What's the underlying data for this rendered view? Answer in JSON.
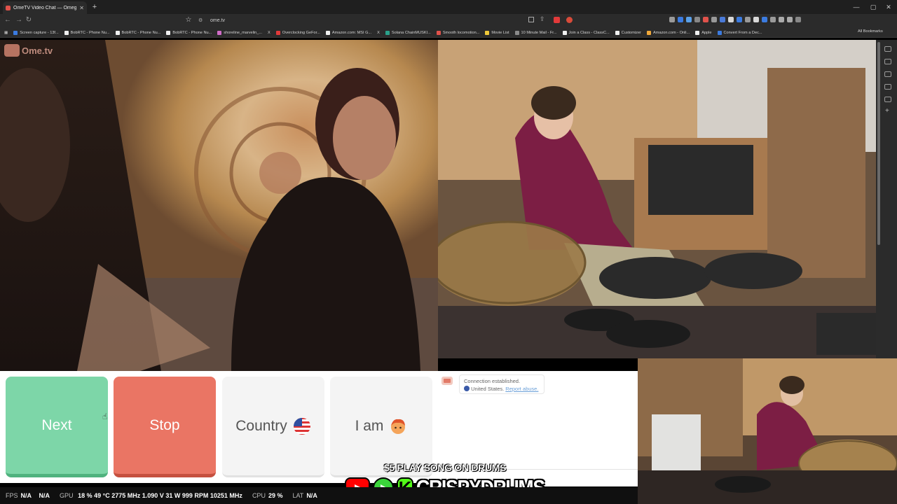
{
  "browser": {
    "tab_title": "OmeTV Video Chat — Omeg",
    "url": "ome.tv",
    "bookmarks": [
      {
        "label": "Screen capture - 13f...",
        "color": "#3b7be0"
      },
      {
        "label": "BobRTC - Phone Nu...",
        "color": "#f0f0f0"
      },
      {
        "label": "BobRTC - Phone Nu...",
        "color": "#f0f0f0"
      },
      {
        "label": "BobRTC - Phone Nu...",
        "color": "#f0f0f0"
      },
      {
        "label": "shoreline_marvelin_...",
        "color": "#d06cc8"
      },
      {
        "label": "X",
        "color": "#2b2b2b"
      },
      {
        "label": "Overclocking GeFor...",
        "color": "#e23a3a"
      },
      {
        "label": "Amazon.com: MSI G...",
        "color": "#f0f0f0"
      },
      {
        "label": "X",
        "color": "#2b2b2b"
      },
      {
        "label": "Solana ChainMUSKI...",
        "color": "#2aa18a"
      },
      {
        "label": "Smooth locomotion...",
        "color": "#e0524b"
      },
      {
        "label": "Movie List",
        "color": "#f0c93a"
      },
      {
        "label": "10 Minute Mail - Fr...",
        "color": "#8a8a8a"
      },
      {
        "label": "Join a Class - ClassC...",
        "color": "#f0f0f0"
      },
      {
        "label": "Customizer",
        "color": "#f0f0f0"
      },
      {
        "label": "Amazon.com - Onli...",
        "color": "#f0a83a"
      },
      {
        "label": "Apple",
        "color": "#f0f0f0"
      },
      {
        "label": "Convert From a Dec...",
        "color": "#3b7be0"
      }
    ],
    "all_bookmarks_label": "All Bookmarks"
  },
  "ometv": {
    "logo_text": "Ome.tv",
    "buttons": {
      "next": "Next",
      "stop": "Stop",
      "country": "Country",
      "i_am": "I am"
    },
    "chat": {
      "status": "Connection established.",
      "location": "United States.",
      "report_link": "Report abuse."
    }
  },
  "overlay": {
    "promo": "$5 PLAY SONG ON DRUMS",
    "handle": "CRISPYDRUMS"
  },
  "stats": {
    "fps_label": "FPS",
    "fps_1": "N/A",
    "fps_2": "N/A",
    "gpu_label": "GPU",
    "gpu_usage": "18 %",
    "gpu_temp": "49 °C",
    "gpu_clock": "2775 MHz",
    "gpu_volt": "1.090 V",
    "gpu_power": "31 W",
    "gpu_fan": "999 RPM",
    "gpu_mem": "10251 MHz",
    "cpu_label": "CPU",
    "cpu_usage": "29 %",
    "lat_label": "LAT",
    "lat_value": "N/A"
  },
  "colors": {
    "next": "#7dd6a8",
    "stop": "#ea7564",
    "neutral_button": "#f4f4f4"
  }
}
